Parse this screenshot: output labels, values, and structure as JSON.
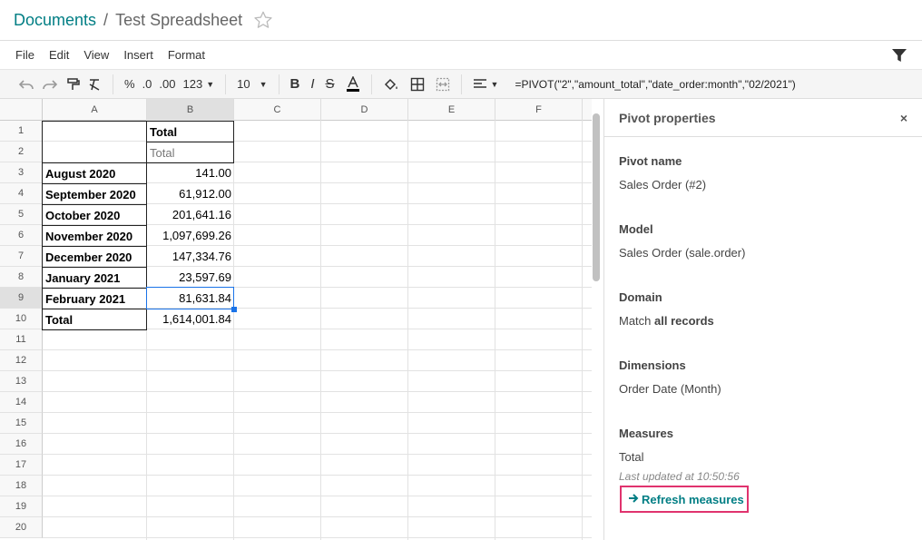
{
  "breadcrumb": {
    "parent": "Documents",
    "separator": "/",
    "current": "Test Spreadsheet"
  },
  "menu": [
    "File",
    "Edit",
    "View",
    "Insert",
    "Format"
  ],
  "toolbar": {
    "percent": "%",
    "decrease_decimals": ".0",
    "increase_decimals": ".00",
    "number_format": "123",
    "font_size": "10",
    "formula": "=PIVOT(\"2\",\"amount_total\",\"date_order:month\",\"02/2021\")"
  },
  "grid": {
    "columns": [
      "A",
      "B",
      "C",
      "D",
      "E",
      "F"
    ],
    "rows": [
      "1",
      "2",
      "3",
      "4",
      "5",
      "6",
      "7",
      "8",
      "9",
      "10",
      "11",
      "12",
      "13",
      "14",
      "15",
      "16",
      "17",
      "18",
      "19",
      "20"
    ],
    "pivot": {
      "header_col": "Total",
      "header_measure": "Total",
      "rows": [
        {
          "label": "August 2020",
          "value": "141.00"
        },
        {
          "label": "September 2020",
          "value": "61,912.00"
        },
        {
          "label": "October 2020",
          "value": "201,641.16"
        },
        {
          "label": "November 2020",
          "value": "1,097,699.26"
        },
        {
          "label": "December 2020",
          "value": "147,334.76"
        },
        {
          "label": "January 2021",
          "value": "23,597.69"
        },
        {
          "label": "February 2021",
          "value": "81,631.84"
        },
        {
          "label": "Total",
          "value": "1,614,001.84"
        }
      ]
    }
  },
  "panel": {
    "title": "Pivot properties",
    "close": "×",
    "pivot_name_label": "Pivot name",
    "pivot_name": "Sales Order (#2)",
    "model_label": "Model",
    "model": "Sales Order (sale.order)",
    "domain_label": "Domain",
    "domain_prefix": "Match",
    "domain_bold": "all records",
    "dimensions_label": "Dimensions",
    "dimensions": "Order Date (Month)",
    "measures_label": "Measures",
    "measures": "Total",
    "last_updated": "Last updated at 10:50:56",
    "refresh": "Refresh measures"
  },
  "colors": {
    "accent": "#017e84",
    "highlight_border": "#e0336e",
    "selection": "#1a73e8"
  }
}
